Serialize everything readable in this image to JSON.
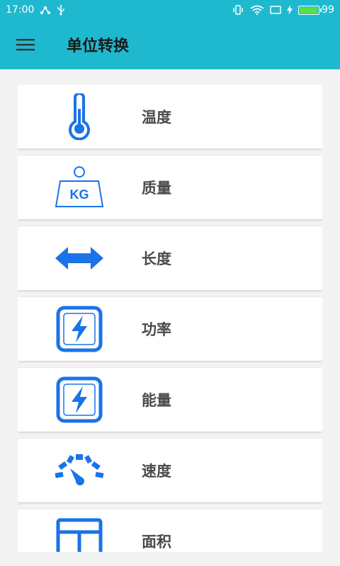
{
  "status_bar": {
    "time": "17:00",
    "battery_level": "99"
  },
  "app_bar": {
    "title": "单位转换"
  },
  "colors": {
    "primary": "#1fb9cf",
    "icon_blue": "#1a73e8",
    "label_text": "#4a4a4a"
  },
  "categories": [
    {
      "label": "温度",
      "icon": "thermometer-icon"
    },
    {
      "label": "质量",
      "icon": "weight-kg-icon",
      "icon_text": "KG"
    },
    {
      "label": "长度",
      "icon": "double-arrow-icon"
    },
    {
      "label": "功率",
      "icon": "lightning-box-icon"
    },
    {
      "label": "能量",
      "icon": "lightning-box-icon"
    },
    {
      "label": "速度",
      "icon": "speedometer-icon"
    },
    {
      "label": "面积",
      "icon": "area-frame-icon"
    }
  ]
}
